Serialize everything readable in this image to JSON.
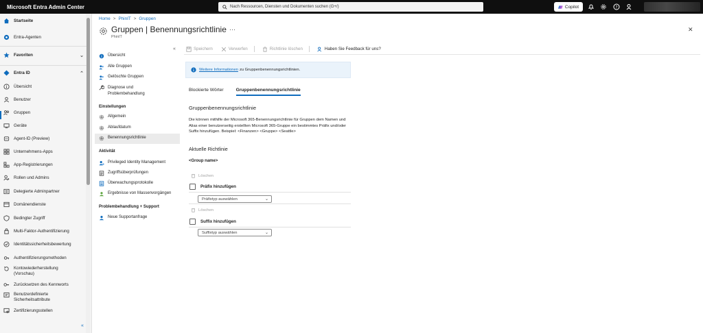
{
  "topbar": {
    "app_title": "Microsoft Entra Admin Center",
    "search_placeholder": "Nach Ressourcen, Diensten und Dokumenten suchen (G+/)",
    "copilot_label": "Copilot"
  },
  "leftnav": {
    "items": [
      {
        "label": "Startseite",
        "bold": true
      },
      {
        "label": "Entra-Agenten"
      },
      {
        "label": "Favoriten",
        "bold": true
      },
      {
        "label": "Entra ID",
        "bold": true
      },
      {
        "label": "Übersicht"
      },
      {
        "label": "Benutzer"
      },
      {
        "label": "Gruppen"
      },
      {
        "label": "Geräte"
      },
      {
        "label": "Agent-ID (Preview)"
      },
      {
        "label": "Unternehmens-Apps"
      },
      {
        "label": "App-Registrierungen"
      },
      {
        "label": "Rollen und Admins"
      },
      {
        "label": "Delegierte Adminpartner"
      },
      {
        "label": "Domänendienste"
      },
      {
        "label": "Bedingter Zugriff"
      },
      {
        "label": "Multi-Faktor-Authentifizierung"
      },
      {
        "label": "Identitätssicherheitsbewertung"
      },
      {
        "label": "Authentifizierungsmethoden"
      },
      {
        "label": "Kontowiederherstellung (Vorschau)"
      },
      {
        "label": "Zurücksetzen des Kennworts"
      },
      {
        "label": "Benutzerdefinierte Sicherheitsattribute"
      },
      {
        "label": "Zertifizierungsstellen"
      }
    ],
    "collapse_label": "«"
  },
  "breadcrumb": [
    "Home",
    "PhinIT",
    "Gruppen"
  ],
  "breadcrumb_sep": ">",
  "page": {
    "title": "Gruppen | Benennungsrichtlinie",
    "subtitle": "PhinIT",
    "more": "···",
    "close": "✕"
  },
  "subnav": {
    "collapse": "«",
    "items_top": [
      "Übersicht",
      "Alle Gruppen",
      "Gelöschte Gruppen",
      "Diagnose und Problembehandlung"
    ],
    "settings_heading": "Einstellungen",
    "settings_items": [
      "Allgemein",
      "Ablaufdatum",
      "Benennungsrichtlinie"
    ],
    "activity_heading": "Aktivität",
    "activity_items": [
      "Privileged Identity Management",
      "Zugriffsüberprüfungen",
      "Überwachungsprotokolle",
      "Ergebnisse von Massenvorgängen"
    ],
    "support_heading": "Problembehandlung + Support",
    "support_items": [
      "Neue Supportanfrage"
    ]
  },
  "toolbar": {
    "save": "Speichern",
    "discard": "Verwerfen",
    "delete_policy": "Richtlinie löschen",
    "feedback": "Haben Sie Feedback für uns?"
  },
  "info": {
    "link": "Weitere Informationen",
    "text": "zu Gruppenbenennungsrichtlinien."
  },
  "tabs": [
    "Blockierte Wörter",
    "Gruppenbenennungsrichtlinie"
  ],
  "content": {
    "section_title": "Gruppenbenennungsrichtlinie",
    "description": "Die können mithilfe der Microsoft 365-Benennungsrichtlinie für Gruppen dem Namen und Alias einer benutzerseitig erstellten Microsoft 365-Gruppe ein bestimmtes Präfix und/oder Suffix hinzufügen. Beispiel: <Finanzen> <Gruppe> <Seattle>",
    "current_title": "Aktuelle Richtlinie",
    "group_name": "<Group name>",
    "delete_label": "Löschen",
    "prefix_label": "Präfix hinzufügen",
    "prefix_placeholder": "Präfixtyp auswählen",
    "suffix_label": "Suffix hinzufügen",
    "suffix_placeholder": "Suffixtyp auswählen"
  },
  "colors": {
    "accent": "#0f6cbd",
    "topbar": "#0f0f0f",
    "info_bg": "#eaf3fb"
  }
}
